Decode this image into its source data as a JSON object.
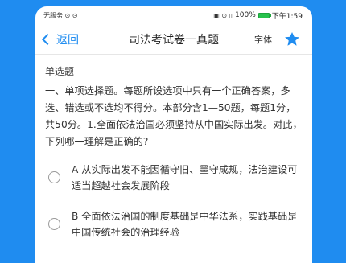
{
  "status_bar": {
    "left": "无服务 ⊙ ⊙",
    "right_icons": "▣ ⊙ ▯",
    "battery": "100%",
    "time": "下午1:59"
  },
  "nav": {
    "back_label": "返回",
    "title": "司法考试卷一真题",
    "font_label": "字体",
    "star_icon": "star-icon",
    "accent_color": "#1f8cf0"
  },
  "question": {
    "type_label": "单选题",
    "text": "一、单项选择题。每题所设选项中只有一个正确答案，多选、错选或不选均不得分。本部分含1—50题，每题1分，共50分。1.全面依法治国必须坚持从中国实际出发。对此，下列哪一理解是正确的?",
    "options": [
      {
        "text": "A 从实际出发不能因循守旧、墨守成规，法治建设可适当超越社会发展阶段"
      },
      {
        "text": "B 全面依法治国的制度基础是中华法系，实践基础是中国传统社会的治理经验"
      }
    ]
  }
}
